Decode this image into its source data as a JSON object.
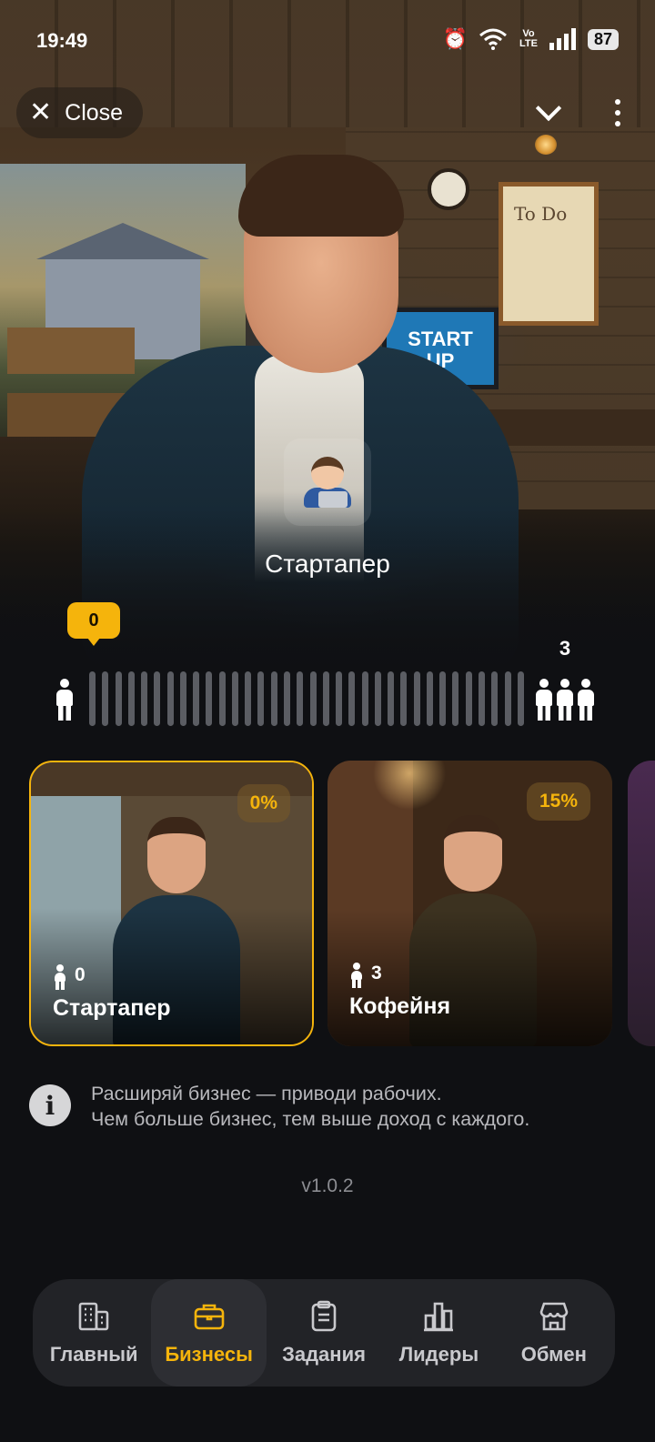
{
  "status_bar": {
    "time": "19:49",
    "battery": "87",
    "network": "Vo LTE"
  },
  "top_controls": {
    "close_label": "Close"
  },
  "level": {
    "name": "Стартапер",
    "current_workers": "0",
    "next_level_workers": "3",
    "progress_fraction": 0,
    "progress_segments": 34
  },
  "businesses": [
    {
      "name": "Стартапер",
      "workers": "0",
      "percent": "0%",
      "active": true
    },
    {
      "name": "Кофейня",
      "workers": "3",
      "percent": "15%",
      "active": false
    }
  ],
  "info": {
    "line1": "Расширяй бизнес — приводи рабочих.",
    "line2": "Чем больше бизнес, тем выше доход с каждого."
  },
  "version": "v1.0.2",
  "hero_scene": {
    "todo_text": "To Do",
    "monitor_text_1": "START",
    "monitor_text_2": "UP"
  },
  "nav": {
    "items": [
      {
        "label": "Главный",
        "icon": "building-icon"
      },
      {
        "label": "Бизнесы",
        "icon": "briefcase-icon"
      },
      {
        "label": "Задания",
        "icon": "clipboard-icon"
      },
      {
        "label": "Лидеры",
        "icon": "bar-chart-icon"
      },
      {
        "label": "Обмен",
        "icon": "shop-icon"
      }
    ],
    "active_index": 1
  },
  "colors": {
    "accent": "#f5b40c",
    "background": "#0f1013",
    "nav_bg": "#222327"
  }
}
